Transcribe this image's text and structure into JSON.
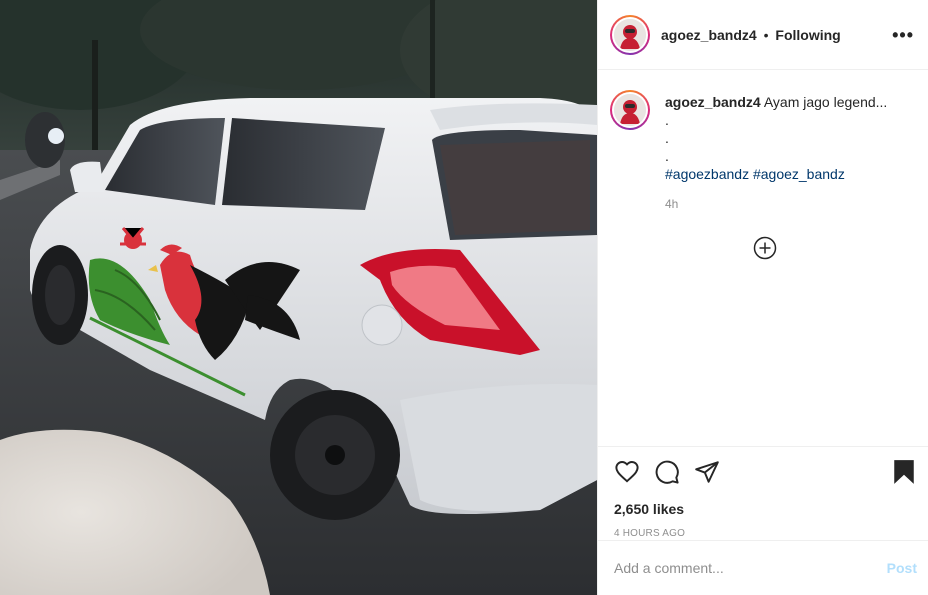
{
  "post": {
    "image_alt_subject": "white hatchback car with rooster decal",
    "username": "agoez_bandz4",
    "follow_state": "Following",
    "separator": "•",
    "more_label": "•••"
  },
  "caption": {
    "username": "agoez_bandz4",
    "text": "Ayam jago legend...",
    "lines": [
      ".",
      ".",
      "."
    ],
    "hashtag1": "#agoezbandz",
    "hashtag2": "#agoez_bandz",
    "time": "4h"
  },
  "actions": {
    "likes": "2,650 likes",
    "date": "4 HOURS AGO",
    "icons": [
      "heart-icon",
      "comment-icon",
      "share-icon",
      "bookmark-icon"
    ]
  },
  "comment": {
    "placeholder": "Add a comment...",
    "post_label": "Post"
  },
  "colors": {
    "accent_link": "#00376b",
    "post_disabled": "#b2dffc",
    "meta_gray": "#8e8e8e"
  }
}
